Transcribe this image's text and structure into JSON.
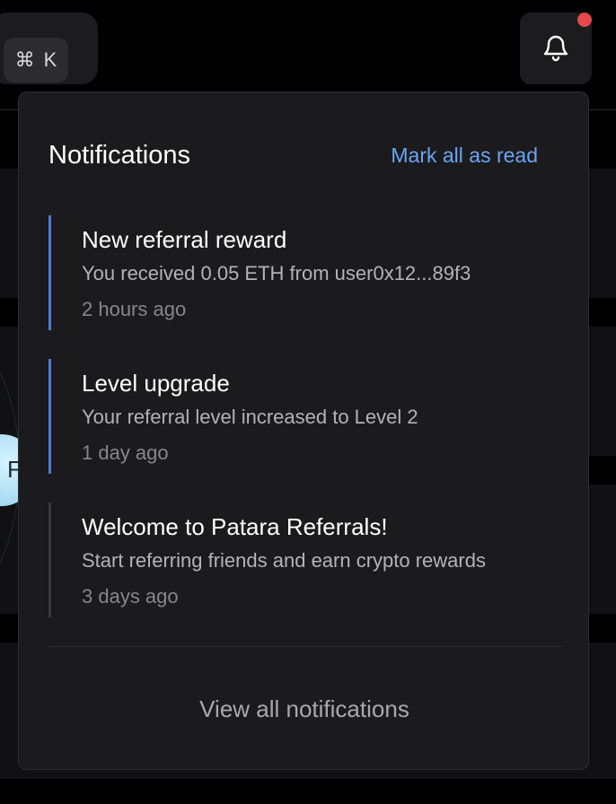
{
  "search_shortcut": {
    "symbol": "⌘",
    "key": "K"
  },
  "colors": {
    "accent_blue": "#6aa5f5",
    "unread_bar": "#4a7ed8",
    "alert_dot": "#e5484d",
    "background": "#000000",
    "panel": "#1b1b1d"
  },
  "dropdown": {
    "title": "Notifications",
    "mark_all_label": "Mark all as read",
    "items": [
      {
        "title": "New referral reward",
        "body": "You received 0.05 ETH from user0x12...89f3",
        "time": "2 hours ago",
        "unread": true
      },
      {
        "title": "Level upgrade",
        "body": "Your referral level increased to Level 2",
        "time": "1 day ago",
        "unread": true
      },
      {
        "title": "Welcome to Patara Referrals!",
        "body": "Start referring friends and earn crypto rewards",
        "time": "3 days ago",
        "unread": false
      }
    ],
    "view_all_label": "View all notifications"
  },
  "background": {
    "orb_letter": "F"
  },
  "icons": {
    "bell": "bell-icon",
    "notification_dot": "notification-dot"
  }
}
